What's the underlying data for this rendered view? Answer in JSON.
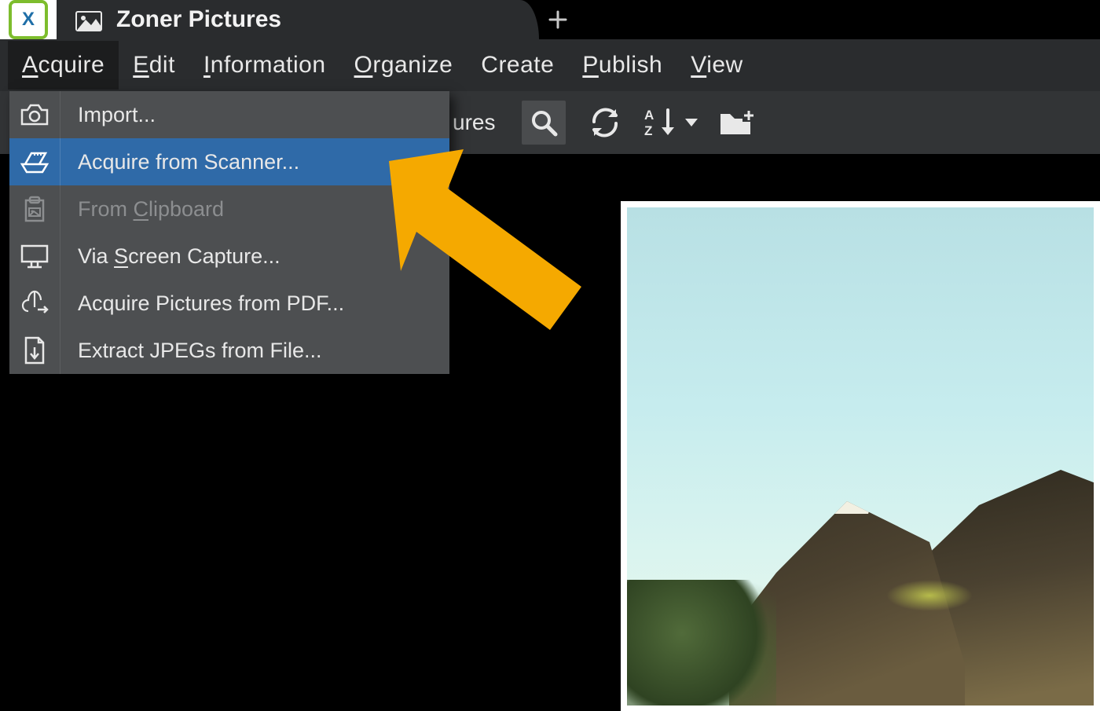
{
  "titlebar": {
    "app_icon_letter": "X",
    "tab_title": "Zoner Pictures"
  },
  "menubar": {
    "items": [
      {
        "label": "Acquire",
        "mnemonic_index": 0,
        "active": true
      },
      {
        "label": "Edit",
        "mnemonic_index": 0
      },
      {
        "label": "Information",
        "mnemonic_index": 0
      },
      {
        "label": "Organize",
        "mnemonic_index": 0
      },
      {
        "label": "Create",
        "mnemonic_index": -1
      },
      {
        "label": "Publish",
        "mnemonic_index": 0
      },
      {
        "label": "View",
        "mnemonic_index": 0
      }
    ]
  },
  "toolbar": {
    "breadcrumb_visible_tail": "ures",
    "icons": {
      "search": "search-icon",
      "refresh": "refresh-icon",
      "sort": "sort-az-icon",
      "new_folder": "new-folder-icon"
    }
  },
  "dropdown": {
    "items": [
      {
        "icon": "camera-icon",
        "label": "Import...",
        "mnemonic_index": -1
      },
      {
        "icon": "scanner-icon",
        "label": "Acquire from Scanner...",
        "mnemonic_index": -1,
        "highlight": true
      },
      {
        "icon": "clipboard-icon",
        "label": "From Clipboard",
        "mnemonic_index": 5,
        "disabled": true
      },
      {
        "icon": "monitor-icon",
        "label": "Via Screen Capture...",
        "mnemonic_index": 4
      },
      {
        "icon": "pdf-icon",
        "label": "Acquire Pictures from PDF...",
        "mnemonic_index": -1
      },
      {
        "icon": "file-extract-icon",
        "label": "Extract JPEGs from File...",
        "mnemonic_index": -1
      }
    ]
  },
  "annotation": {
    "arrow_color": "#f5a900"
  }
}
